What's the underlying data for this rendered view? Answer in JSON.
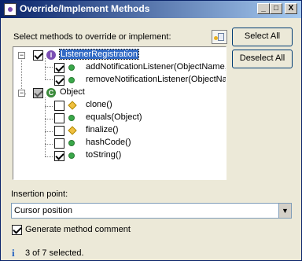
{
  "window": {
    "title": "Override/Implement Methods",
    "app_icon": "eclipse-icon",
    "minimize_label": "_",
    "maximize_label": "□",
    "close_label": "X"
  },
  "prompt": "Select methods to override or implement:",
  "buttons": {
    "select_all": "Select All",
    "deselect_all": "Deselect All"
  },
  "tree": {
    "nodes": [
      {
        "label": "ListenerRegistration",
        "checked": true,
        "icon": "interface-icon",
        "expander": "−"
      },
      {
        "label": "addNotificationListener(ObjectName,",
        "checked": true,
        "icon": "public-method-icon"
      },
      {
        "label": "removeNotificationListener(ObjectNan",
        "checked": true,
        "icon": "public-method-icon"
      },
      {
        "label": "Object",
        "checked": true,
        "icon": "class-icon",
        "expander": "−"
      },
      {
        "label": "clone()",
        "checked": false,
        "icon": "protected-method-icon"
      },
      {
        "label": "equals(Object)",
        "checked": false,
        "icon": "public-method-icon"
      },
      {
        "label": "finalize()",
        "checked": false,
        "icon": "protected-method-icon"
      },
      {
        "label": "hashCode()",
        "checked": false,
        "icon": "public-method-icon"
      },
      {
        "label": "toString()",
        "checked": true,
        "icon": "public-method-icon"
      }
    ],
    "interface_glyph": "I",
    "class_glyph": "C"
  },
  "insertion": {
    "label": "Insertion point:",
    "value": "Cursor position"
  },
  "generate_comment": {
    "label": "Generate method comment",
    "checked": true
  },
  "status": {
    "icon_glyph": "i",
    "text": "3 of 7 selected."
  }
}
